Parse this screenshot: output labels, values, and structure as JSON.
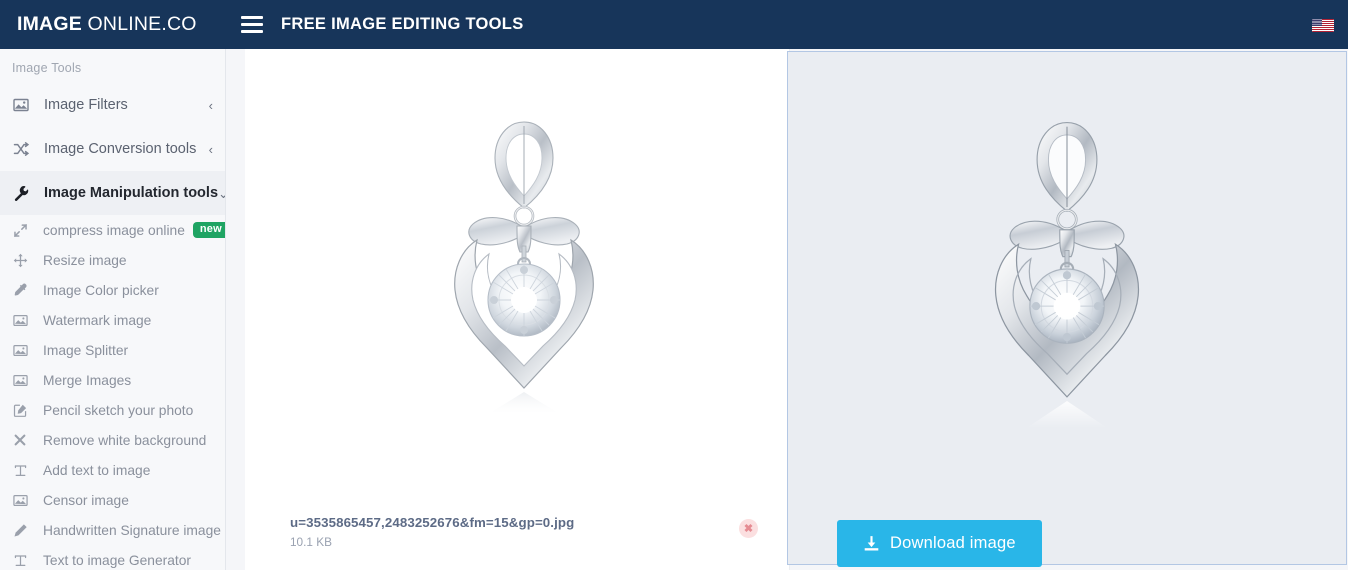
{
  "header": {
    "brand_strong": "IMAGE",
    "brand_light": " ONLINE.CO",
    "menu_icon": "hamburger-icon",
    "title": "FREE IMAGE EDITING TOOLS",
    "flag_icon": "us-flag-icon",
    "bg_color": "#17355a"
  },
  "sidebar": {
    "caption": "Image Tools",
    "groups": [
      {
        "label": "Image Filters",
        "icon": "image-icon",
        "chevron": "‹",
        "active": false
      },
      {
        "label": "Image Conversion tools",
        "icon": "shuffle-icon",
        "chevron": "‹",
        "active": false
      },
      {
        "label": "Image Manipulation tools",
        "icon": "wrench-icon",
        "chevron": "⌄",
        "active": true
      }
    ],
    "items": [
      {
        "label": "compress image online",
        "icon": "compress-icon",
        "badge": "new"
      },
      {
        "label": "Resize image",
        "icon": "move-arrows-icon",
        "badge": ""
      },
      {
        "label": "Image Color picker",
        "icon": "eyedropper-icon",
        "badge": ""
      },
      {
        "label": "Watermark image",
        "icon": "image-icon",
        "badge": ""
      },
      {
        "label": "Image Splitter",
        "icon": "image-icon",
        "badge": ""
      },
      {
        "label": "Merge Images",
        "icon": "image-icon",
        "badge": ""
      },
      {
        "label": "Pencil sketch your photo",
        "icon": "edit-square-icon",
        "badge": ""
      },
      {
        "label": "Remove white background",
        "icon": "close-x-icon",
        "badge": ""
      },
      {
        "label": "Add text to image",
        "icon": "text-t-icon",
        "badge": ""
      },
      {
        "label": "Censor image",
        "icon": "image-icon",
        "badge": ""
      },
      {
        "label": "Handwritten Signature image",
        "icon": "pencil-icon",
        "badge": ""
      },
      {
        "label": "Text to image Generator",
        "icon": "text-t-icon",
        "badge": ""
      }
    ]
  },
  "workspace": {
    "source": {
      "preview_alt": "silver heart pendant with bow and diamond on white background",
      "file_name": "u=3535865457,2483252676&fm=15&gp=0.jpg",
      "file_size": "10.1 KB",
      "remove_icon": "close-x-icon",
      "remove_glyph": "✖"
    },
    "result": {
      "preview_alt": "silver heart pendant with bow and diamond, white background removed",
      "download_label": "Download image",
      "download_icon": "download-icon",
      "download_color": "#29b6e8",
      "panel_border_color": "#b3c7e4"
    }
  }
}
